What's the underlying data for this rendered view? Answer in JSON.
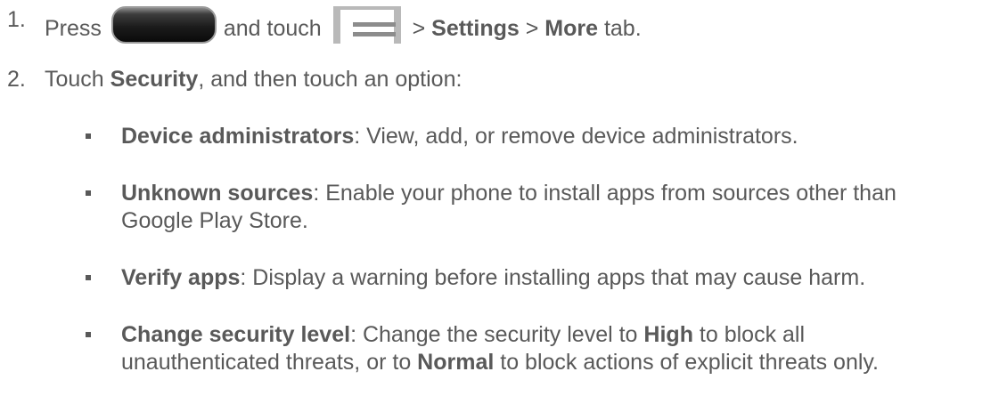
{
  "steps": [
    {
      "number": "1.",
      "press": "Press",
      "home_key_icon": "home-key-icon",
      "and_touch": "and touch",
      "menu_key_icon": "menu-key-icon",
      "sep1": " > ",
      "settings": "Settings",
      "sep2": " > ",
      "more": "More",
      "tab": " tab."
    },
    {
      "number": "2.",
      "touch": "Touch ",
      "security": "Security",
      "rest": ", and then touch an option:"
    }
  ],
  "options": [
    {
      "term": "Device administrators",
      "line1": ": View, add, or remove device administrators."
    },
    {
      "term": "Unknown sources",
      "line1": ": Enable your phone to install apps from sources other than",
      "line2": "Google Play Store."
    },
    {
      "term": "Verify apps",
      "line1": ": Display a warning before installing apps that may cause harm."
    },
    {
      "term": "Change security level",
      "line1_a": ": Change the security level to ",
      "high": "High",
      "line1_b": " to block all",
      "line2_a": "unauthenticated threats, or to ",
      "normal": "Normal",
      "line2_b": " to block actions of explicit threats only."
    }
  ]
}
